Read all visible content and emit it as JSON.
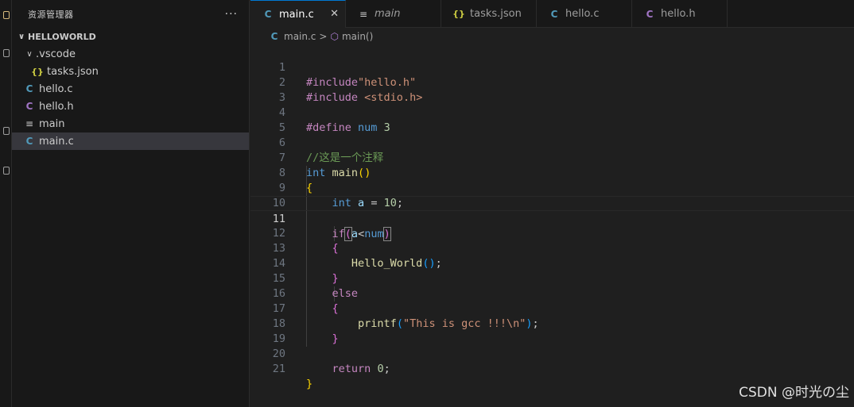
{
  "sidebar": {
    "title": "资源管理器",
    "more": "···",
    "section": "HELLOWORLD",
    "items": [
      {
        "label": ".vscode",
        "icon": "chevron-down-icon",
        "indent": 1
      },
      {
        "label": "tasks.json",
        "icon": "json-icon",
        "indent": 2
      },
      {
        "label": "hello.c",
        "icon": "c-file-icon",
        "indent": 1
      },
      {
        "label": "hello.h",
        "icon": "h-file-icon",
        "indent": 1
      },
      {
        "label": "main",
        "icon": "binary-file-icon",
        "indent": 1
      },
      {
        "label": "main.c",
        "icon": "c-file-icon",
        "indent": 1,
        "selected": true
      }
    ]
  },
  "tabs": [
    {
      "label": "main.c",
      "icon": "C",
      "active": true,
      "close": "✕"
    },
    {
      "label": "main",
      "icon": "≡",
      "italic": true
    },
    {
      "label": "tasks.json",
      "icon": "{}"
    },
    {
      "label": "hello.c",
      "icon": "C"
    },
    {
      "label": "hello.h",
      "icon": "C"
    }
  ],
  "breadcrumb": {
    "file": "main.c",
    "separator": ">",
    "symbol": "main()"
  },
  "editor": {
    "current_line": 11,
    "lines": [
      {
        "n": "1"
      },
      {
        "n": "2"
      },
      {
        "n": "3"
      },
      {
        "n": "4"
      },
      {
        "n": "5"
      },
      {
        "n": "6"
      },
      {
        "n": "7"
      },
      {
        "n": "8"
      },
      {
        "n": "9"
      },
      {
        "n": "10"
      },
      {
        "n": "11"
      },
      {
        "n": "12"
      },
      {
        "n": "13"
      },
      {
        "n": "14"
      },
      {
        "n": "15"
      },
      {
        "n": "16"
      },
      {
        "n": "17"
      },
      {
        "n": "18"
      },
      {
        "n": "19"
      },
      {
        "n": "20"
      },
      {
        "n": "21"
      }
    ],
    "tokens": {
      "l1": "#include\"hello.h\"",
      "l1_pp": "#include",
      "l1_str": "\"hello.h\"",
      "l2_pp": "#include",
      "l2_str": "<stdio.h>",
      "l4_pp": "#define",
      "l4_id": "num",
      "l4_num": "3",
      "l6_cm": "//这是一个注释",
      "l7_kw": "int",
      "l7_fn": "main",
      "l7_open": "(",
      "l7_close": ")",
      "l8_brace": "{",
      "l9_kw": "int",
      "l9_id": "a",
      "l9_eq": " = ",
      "l9_num": "10",
      "l9_semi": ";",
      "l11_kw": "if",
      "l11_open": "(",
      "l11_a": "a",
      "l11_lt": "<",
      "l11_num": "num",
      "l11_close": ")",
      "l12_brace": "{",
      "l13_fn": "Hello_World",
      "l13_open": "(",
      "l13_close": ")",
      "l13_semi": ";",
      "l14_brace": "}",
      "l15_kw": "else",
      "l16_brace": "{",
      "l17_fn": "printf",
      "l17_open": "(",
      "l17_str": "\"This is gcc !!!\\n\"",
      "l17_close": ")",
      "l17_semi": ";",
      "l18_brace": "}",
      "l20_kw": "return",
      "l20_num": "0",
      "l20_semi": ";",
      "l21_brace": "}"
    }
  },
  "watermark": "CSDN @时光の尘"
}
